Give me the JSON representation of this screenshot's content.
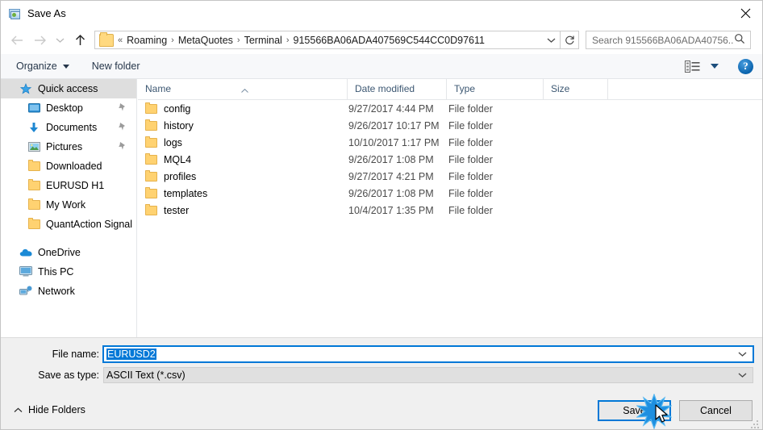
{
  "window": {
    "title": "Save As",
    "app_icon": "photo-app-icon",
    "close_label": "✕"
  },
  "nav": {
    "back_icon": "arrow-left-icon",
    "forward_icon": "arrow-right-icon",
    "recent_icon": "chevron-down-icon",
    "up_icon": "arrow-up-icon",
    "refresh_icon": "refresh-icon",
    "breadcrumb_prefix": "«",
    "breadcrumbs": [
      "Roaming",
      "MetaQuotes",
      "Terminal",
      "915566BA06ADA407569C544CC0D97611"
    ],
    "separator": "›",
    "dropdown_icon": "chevron-down-icon"
  },
  "search": {
    "placeholder": "Search 915566BA06ADA40756...",
    "icon": "search-icon"
  },
  "toolbar": {
    "organize_label": "Organize",
    "new_folder_label": "New folder",
    "view_icon": "view-layout-icon",
    "view_caret_icon": "chevron-down-icon",
    "help_label": "?"
  },
  "sidebar": {
    "items": [
      {
        "label": "Quick access",
        "icon": "star-pin-icon",
        "indent": 0,
        "selected": true,
        "pinned": false
      },
      {
        "label": "Desktop",
        "icon": "desktop-icon",
        "indent": 1,
        "selected": false,
        "pinned": true
      },
      {
        "label": "Documents",
        "icon": "documents-arrow-icon",
        "indent": 1,
        "selected": false,
        "pinned": true
      },
      {
        "label": "Pictures",
        "icon": "pictures-icon",
        "indent": 1,
        "selected": false,
        "pinned": true
      },
      {
        "label": "Downloaded",
        "icon": "folder-icon",
        "indent": 1,
        "selected": false,
        "pinned": false
      },
      {
        "label": "EURUSD H1",
        "icon": "folder-icon",
        "indent": 1,
        "selected": false,
        "pinned": false
      },
      {
        "label": "My Work",
        "icon": "folder-icon",
        "indent": 1,
        "selected": false,
        "pinned": false
      },
      {
        "label": "QuantAction Signal",
        "icon": "folder-icon",
        "indent": 1,
        "selected": false,
        "pinned": false
      },
      {
        "label": "OneDrive",
        "icon": "onedrive-cloud-icon",
        "indent": 0,
        "selected": false,
        "pinned": false
      },
      {
        "label": "This PC",
        "icon": "monitor-icon",
        "indent": 0,
        "selected": false,
        "pinned": false
      },
      {
        "label": "Network",
        "icon": "network-icon",
        "indent": 0,
        "selected": false,
        "pinned": false
      }
    ]
  },
  "filelist": {
    "columns": [
      "Name",
      "Date modified",
      "Type",
      "Size"
    ],
    "sorted_by": "Name",
    "sort_direction": "ascending",
    "rows": [
      {
        "name": "config",
        "date": "9/27/2017 4:44 PM",
        "type": "File folder",
        "size": ""
      },
      {
        "name": "history",
        "date": "9/26/2017 10:17 PM",
        "type": "File folder",
        "size": ""
      },
      {
        "name": "logs",
        "date": "10/10/2017 1:17 PM",
        "type": "File folder",
        "size": ""
      },
      {
        "name": "MQL4",
        "date": "9/26/2017 1:08 PM",
        "type": "File folder",
        "size": ""
      },
      {
        "name": "profiles",
        "date": "9/27/2017 4:21 PM",
        "type": "File folder",
        "size": ""
      },
      {
        "name": "templates",
        "date": "9/26/2017 1:08 PM",
        "type": "File folder",
        "size": ""
      },
      {
        "name": "tester",
        "date": "10/4/2017 1:35 PM",
        "type": "File folder",
        "size": ""
      }
    ]
  },
  "form": {
    "filename_label": "File name:",
    "filename_value": "EURUSD2",
    "savetype_label": "Save as type:",
    "savetype_value": "ASCII Text (*.csv)",
    "dropdown_icon": "chevron-down-icon"
  },
  "footer": {
    "hide_folders_label": "Hide Folders",
    "hide_folders_icon": "chevron-up-icon",
    "save_label": "Save",
    "cancel_label": "Cancel",
    "resize_grip_icon": "resize-grip-icon"
  },
  "pointer": {
    "cursor_icon": "mouse-pointer-icon",
    "click_effect_icon": "click-burst-icon"
  },
  "colors": {
    "accent": "#0078d7",
    "folder": "#ffd271",
    "header_text": "#3c5772",
    "chrome_bg": "#f0f0f0"
  }
}
